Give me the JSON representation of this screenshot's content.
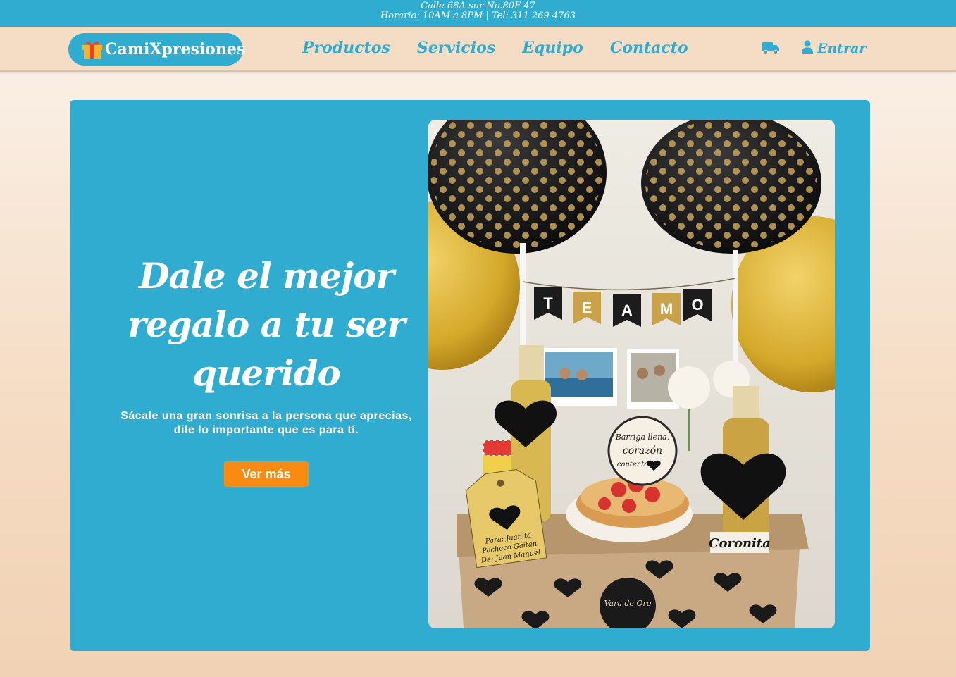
{
  "topbar": {
    "address": "Calle 68A sur No.80F 47",
    "hours": "Horario: 10AM a 8PM | Tel: 311 269 4763"
  },
  "brand": {
    "name": "CamiXpresiones",
    "icon": "gift-icon"
  },
  "nav": {
    "items": [
      {
        "label": "Productos"
      },
      {
        "label": "Servicios"
      },
      {
        "label": "Equipo"
      },
      {
        "label": "Contacto"
      }
    ],
    "shipping_icon": "truck-icon",
    "login_icon": "user-icon",
    "login_label": "Entrar"
  },
  "hero": {
    "title": "Dale el mejor regalo a tu ser querido",
    "subtitle": "Sácale una gran sonrisa a la persona que aprecias, dile lo importante que es para tí.",
    "cta_label": "Ver más",
    "image": {
      "banner_letters": [
        "T",
        "E",
        "A",
        "M",
        "O"
      ],
      "tag_lines": [
        "Para: Juanita",
        "Pacheco Gaitan",
        "De: Juan Manuel"
      ],
      "badge_lines": [
        "Barriga llena,",
        "corazón",
        "contento"
      ],
      "bottle_label": "Coronita",
      "box_seal": "Vara de Oro"
    }
  },
  "colors": {
    "primary": "#30acd1",
    "accent": "#fb8a10",
    "navbar_bg": "#f4dcc5",
    "page_bg": "#f5dcc4"
  }
}
